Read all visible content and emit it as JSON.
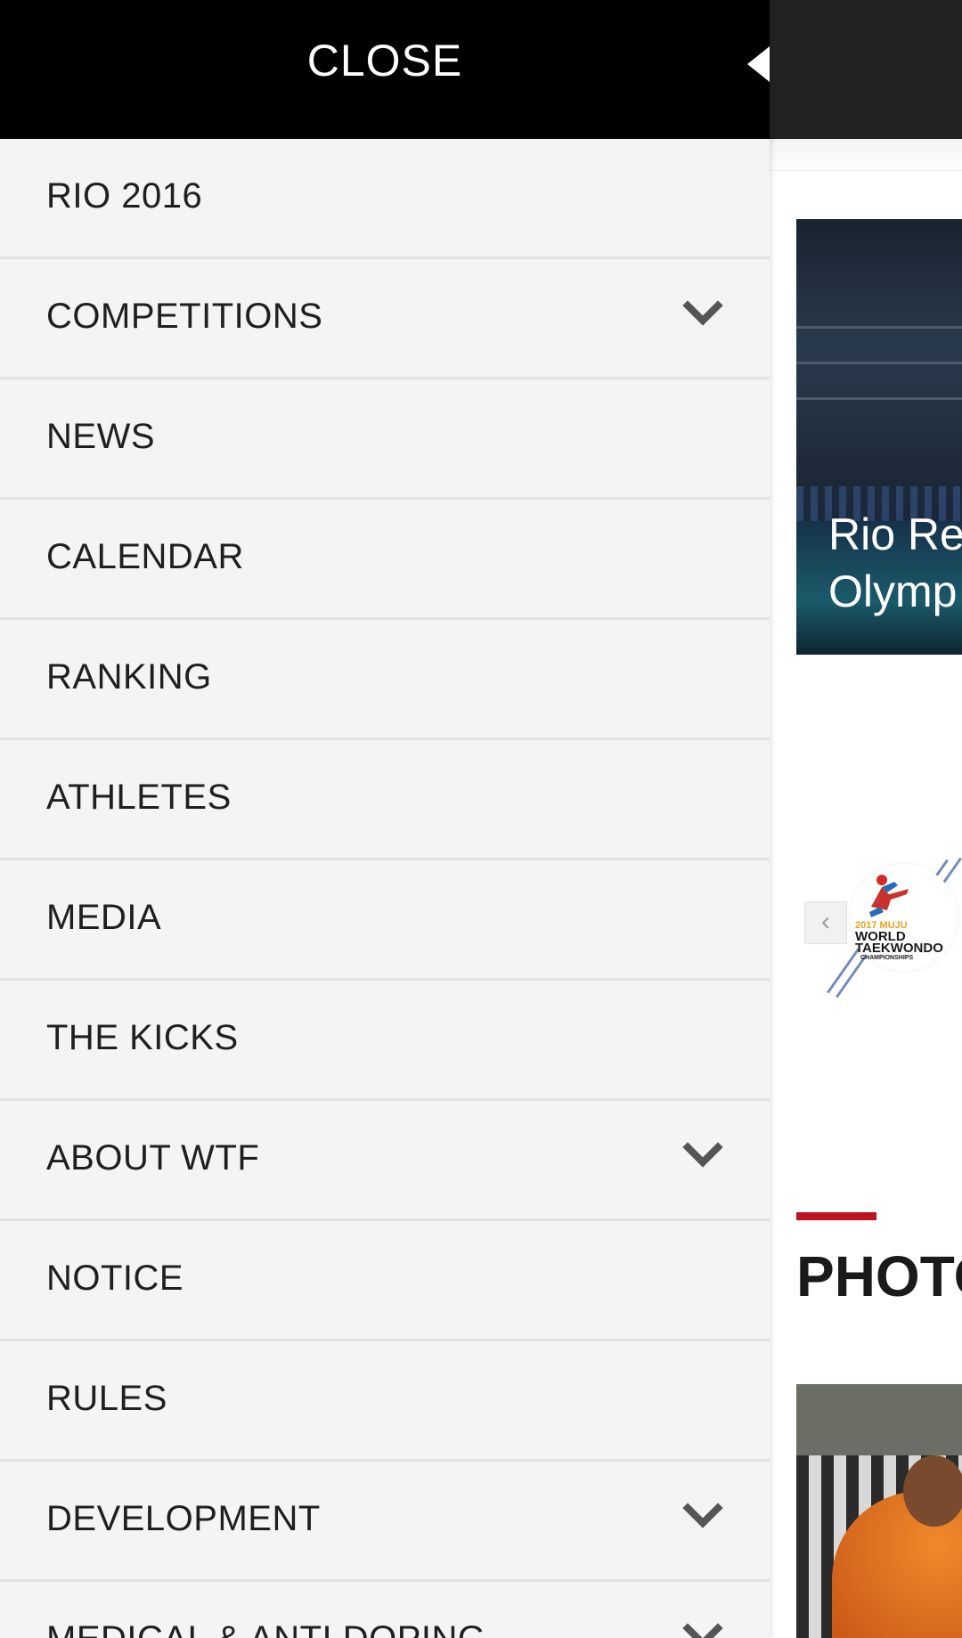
{
  "drawer": {
    "close_label": "CLOSE",
    "items": [
      {
        "label": "RIO 2016",
        "has_submenu": false
      },
      {
        "label": "COMPETITIONS",
        "has_submenu": true
      },
      {
        "label": "NEWS",
        "has_submenu": false
      },
      {
        "label": "CALENDAR",
        "has_submenu": false
      },
      {
        "label": "RANKING",
        "has_submenu": false
      },
      {
        "label": "ATHLETES",
        "has_submenu": false
      },
      {
        "label": "MEDIA",
        "has_submenu": false
      },
      {
        "label": "THE KICKS",
        "has_submenu": false
      },
      {
        "label": "ABOUT WTF",
        "has_submenu": true
      },
      {
        "label": "NOTICE",
        "has_submenu": false
      },
      {
        "label": "RULES",
        "has_submenu": false
      },
      {
        "label": "DEVELOPMENT",
        "has_submenu": true
      },
      {
        "label": "MEDICAL & ANTI DOPING",
        "has_submenu": true
      }
    ]
  },
  "header": {
    "menu_icon": "hamburger-icon"
  },
  "hero": {
    "title": "Rio Re\nOlymp"
  },
  "banner": {
    "prev_glyph": "‹",
    "logo_year": "2017 MUJU",
    "logo_line1": "WORLD",
    "logo_line2": "TAEKWONDO",
    "logo_line3": "CHAMPIONSHIPS"
  },
  "photos_section": {
    "title": "PHOTO"
  },
  "colors": {
    "drawer_bg": "#f4f4f4",
    "close_bar_bg": "#000000",
    "header_bg": "#222222",
    "accent": "#c0111f"
  }
}
